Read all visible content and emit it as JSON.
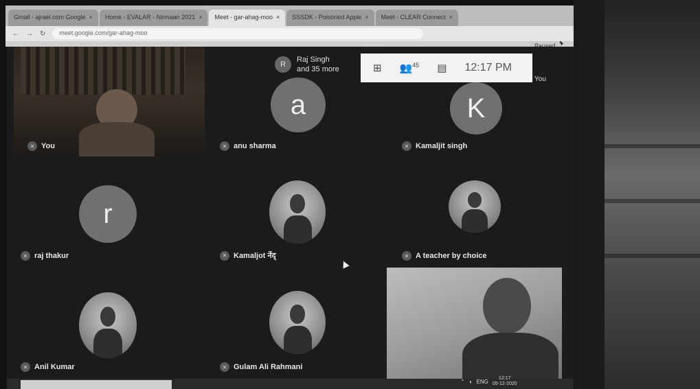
{
  "browser": {
    "tabs": [
      {
        "label": "Gmail - ajrael.com Google"
      },
      {
        "label": "Home - EVALAR - Nirmaan 2021"
      },
      {
        "label": "Meet - gar-ahag-moo",
        "active": true
      },
      {
        "label": "SSSDK - Poisoned Apple"
      },
      {
        "label": "Meet - CLEAR Connect"
      }
    ],
    "url": "meet.google.com/gar-ahag-moo",
    "profile_label": "Paused"
  },
  "meet": {
    "overlay": {
      "participants_count": "45",
      "clock": "12:17 PM",
      "you_label": "You"
    },
    "more_pill": {
      "initial": "R",
      "line1": "Raj Singh",
      "line2": "and 35 more"
    },
    "tiles": [
      {
        "name": "You",
        "type": "video"
      },
      {
        "name": "anu sharma",
        "type": "letter",
        "letter": "a"
      },
      {
        "name": "Kamaljit singh",
        "type": "letter",
        "letter": "K"
      },
      {
        "name": "raj thakur",
        "type": "letter",
        "letter": "r"
      },
      {
        "name": "Kamaljot नेंद्",
        "type": "photo"
      },
      {
        "name": "A teacher by choice",
        "type": "photo"
      },
      {
        "name": "Anil Kumar",
        "type": "photo"
      },
      {
        "name": "Gulam Ali Rahmani",
        "type": "photo"
      },
      {
        "name": "",
        "type": "video"
      }
    ]
  },
  "taskbar": {
    "tray_lang": "ENG",
    "tray_time": "12:17",
    "tray_date": "05-12-2020"
  },
  "colors": {
    "tile_bg": "#1c1c1c",
    "avatar_letter_bg": "#707070",
    "overlay_bg": "#f2f2f2"
  }
}
